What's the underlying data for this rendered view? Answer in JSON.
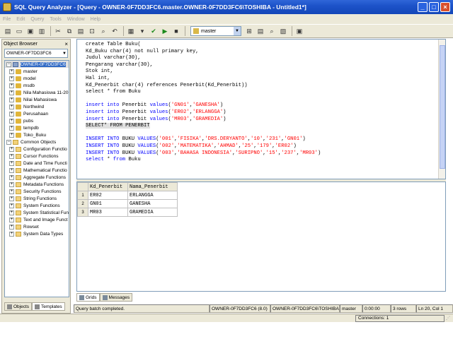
{
  "window": {
    "title": "SQL Query Analyzer - [Query - OWNER-0F7DD3FC6.master.OWNER-0F7DD3FC6\\TOSHIBA - Untitled1*]"
  },
  "menu": [
    "File",
    "Edit",
    "Query",
    "Tools",
    "Window",
    "Help"
  ],
  "toolbar": {
    "database": "master"
  },
  "object_browser": {
    "header": "Object Browser",
    "server": "OWNER-0F7DD3FC6",
    "root": "OWNER-0F7DD3FC6",
    "databases": [
      "master",
      "model",
      "msdb",
      "Nila Mahasiswa 11-20",
      "Nilai Mahasiswa",
      "Northwind",
      "Perusahaan",
      "pubs",
      "tempdb",
      "Toko_Buku"
    ],
    "common_root": "Common Objects",
    "common_objects": [
      "Configuration Functio",
      "Cursor Functions",
      "Date and Time Functi",
      "Mathematical Functio",
      "Aggregate Functions",
      "Metadata Functions",
      "Security Functions",
      "String Functions",
      "System Functions",
      "System Statistical Fun",
      "Text and Image Funct",
      "Rowset",
      "System Data Types"
    ],
    "tabs": [
      "Objects",
      "Templates"
    ]
  },
  "editor": {
    "lines": [
      [
        [
          "",
          "create Table Buku("
        ]
      ],
      [
        [
          "",
          "Kd_Buku char(4) not null primary key,"
        ]
      ],
      [
        [
          "",
          "Judul varchar(30),"
        ]
      ],
      [
        [
          "",
          "Pengarang varchar(30),"
        ]
      ],
      [
        [
          "",
          "Stok int,"
        ]
      ],
      [
        [
          "",
          "Hal int,"
        ]
      ],
      [
        [
          "",
          "Kd_Penerbit char(4) references Penerbit(Kd_Penerbit))"
        ]
      ],
      [
        [
          "",
          "select * from Buku"
        ]
      ],
      [
        [
          "",
          ""
        ]
      ],
      [
        [
          "kw",
          "insert into "
        ],
        [
          "",
          "Penerbit "
        ],
        [
          "kw",
          "values"
        ],
        [
          "",
          "("
        ],
        [
          "str",
          "'GN01'"
        ],
        [
          "",
          ","
        ],
        [
          "str",
          "'GANESHA'"
        ],
        [
          "",
          ")"
        ]
      ],
      [
        [
          "kw",
          "insert into "
        ],
        [
          "",
          "Penerbit "
        ],
        [
          "kw",
          "values"
        ],
        [
          "",
          "("
        ],
        [
          "str",
          "'ER02'"
        ],
        [
          "",
          ","
        ],
        [
          "str",
          "'ERLANGGA'"
        ],
        [
          "",
          ")"
        ]
      ],
      [
        [
          "kw",
          "insert into "
        ],
        [
          "",
          "Penerbit "
        ],
        [
          "kw",
          "values"
        ],
        [
          "",
          "("
        ],
        [
          "str",
          "'MR03'"
        ],
        [
          "",
          ","
        ],
        [
          "str",
          "'GRAMEDIA'"
        ],
        [
          "",
          ")"
        ]
      ],
      [
        [
          "sel",
          "SELECT* FROM PENERBIT"
        ]
      ],
      [
        [
          "",
          ""
        ]
      ],
      [
        [
          "kw",
          "INSERT INTO "
        ],
        [
          "",
          "BUKU "
        ],
        [
          "kw",
          "VALUES"
        ],
        [
          "",
          "("
        ],
        [
          "str",
          "'001'"
        ],
        [
          "",
          ","
        ],
        [
          "str",
          "'FISIKA'"
        ],
        [
          "",
          ","
        ],
        [
          "str",
          "'DRS.DERYANTO'"
        ],
        [
          "",
          ","
        ],
        [
          "str",
          "'10'"
        ],
        [
          "",
          ","
        ],
        [
          "str",
          "'231'"
        ],
        [
          "",
          ","
        ],
        [
          "str",
          "'GN01'"
        ],
        [
          "",
          ")"
        ]
      ],
      [
        [
          "kw",
          "INSERT INTO "
        ],
        [
          "",
          "BUKU "
        ],
        [
          "kw",
          "VALUES"
        ],
        [
          "",
          "("
        ],
        [
          "str",
          "'002'"
        ],
        [
          "",
          ","
        ],
        [
          "str",
          "'MATEMATIKA'"
        ],
        [
          "",
          ","
        ],
        [
          "str",
          "'AHMAD'"
        ],
        [
          "",
          ","
        ],
        [
          "str",
          "'25'"
        ],
        [
          "",
          ","
        ],
        [
          "str",
          "'179'"
        ],
        [
          "",
          ","
        ],
        [
          "str",
          "'ER02'"
        ],
        [
          "",
          ")"
        ]
      ],
      [
        [
          "kw",
          "INSERT INTO "
        ],
        [
          "",
          "BUKU "
        ],
        [
          "kw",
          "VALUES"
        ],
        [
          "",
          "("
        ],
        [
          "str",
          "'003'"
        ],
        [
          "",
          ","
        ],
        [
          "str",
          "'BAHASA INDONESIA'"
        ],
        [
          "",
          ","
        ],
        [
          "str",
          "'SURIPNO'"
        ],
        [
          "",
          ","
        ],
        [
          "str",
          "'15'"
        ],
        [
          "",
          ","
        ],
        [
          "str",
          "'237'"
        ],
        [
          "",
          ","
        ],
        [
          "str",
          "'MR03'"
        ],
        [
          "",
          ")"
        ]
      ],
      [
        [
          "kw",
          "select "
        ],
        [
          "",
          "* "
        ],
        [
          "kw",
          "from "
        ],
        [
          "",
          "Buku"
        ]
      ]
    ]
  },
  "results": {
    "columns": [
      "Kd_Penerbit",
      "Nama_Penerbit"
    ],
    "rows": [
      [
        "1",
        "ER02",
        "ERLANGGA"
      ],
      [
        "2",
        "GN01",
        "GANESHA"
      ],
      [
        "3",
        "MR03",
        "GRAMEDIA"
      ]
    ],
    "tabs": [
      "Grids",
      "Messages"
    ]
  },
  "status": {
    "message": "Query batch completed.",
    "server": "OWNER-0F7DD3FC6 (8.0)",
    "user": "OWNER-0F7DD3FC6\\TOSHIBA (5",
    "db": "master",
    "time": "0:00:00",
    "rows": "3 rows",
    "position": "Ln 20, Col 1",
    "connections": "Connections: 1"
  }
}
